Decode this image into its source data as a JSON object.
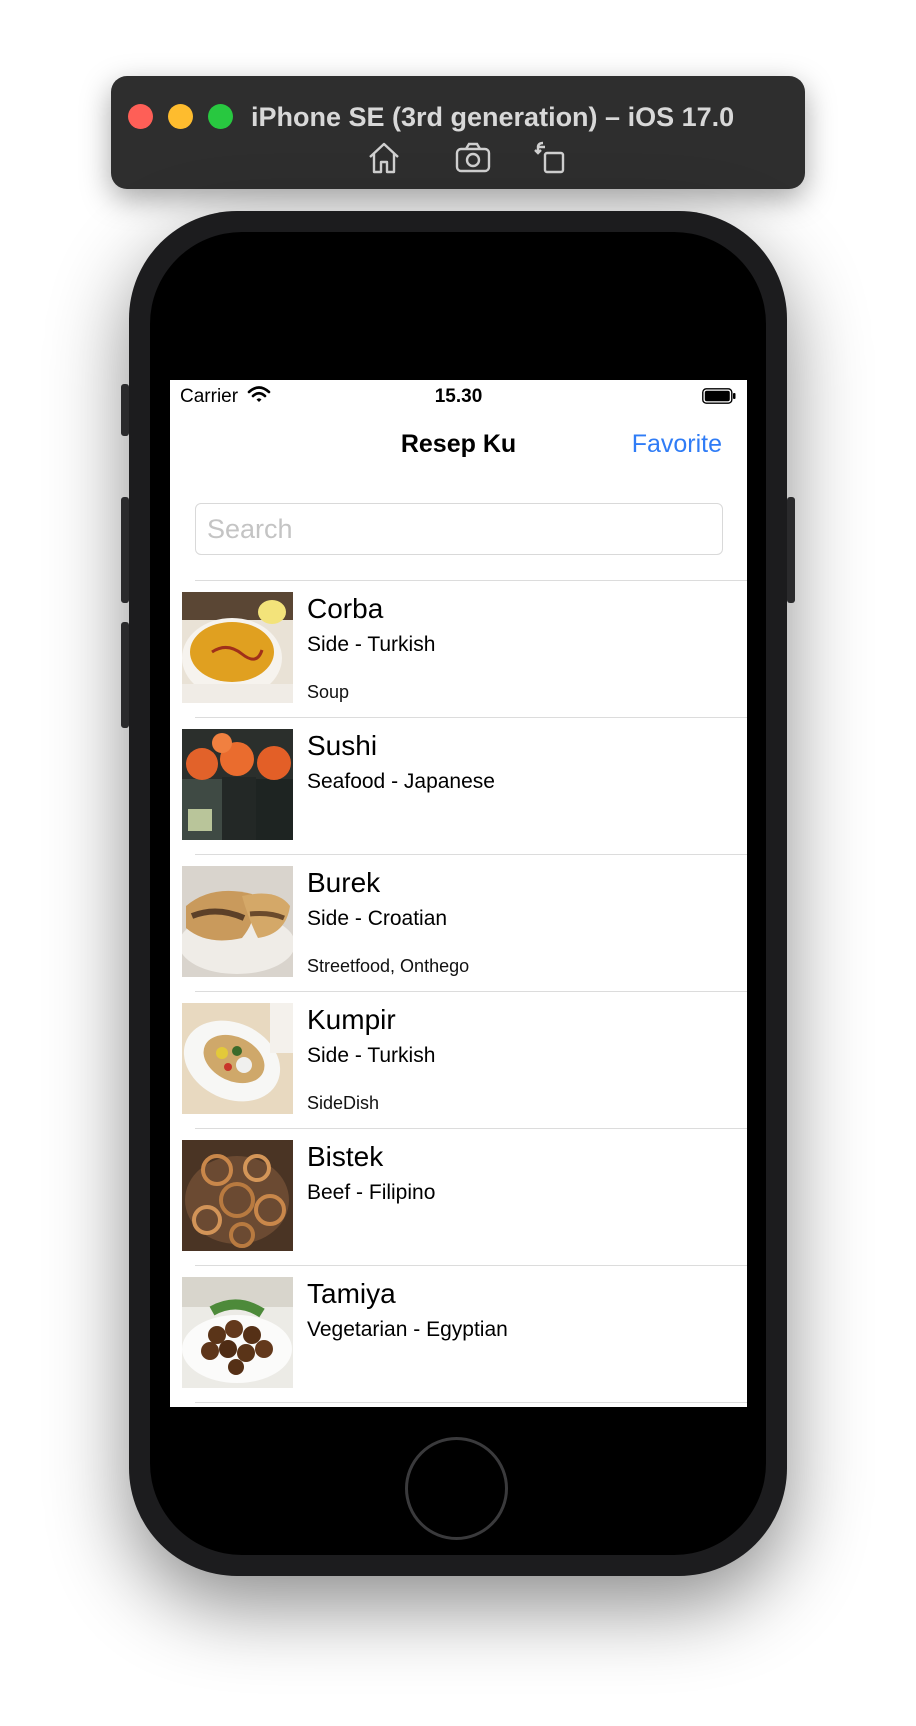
{
  "simulator": {
    "title": "iPhone SE (3rd generation) – iOS 17.0",
    "tools": [
      "home-icon",
      "screenshot-icon",
      "rotate-icon"
    ]
  },
  "status_bar": {
    "carrier": "Carrier",
    "time": "15.30"
  },
  "nav": {
    "title": "Resep Ku",
    "favorite": "Favorite"
  },
  "search": {
    "placeholder": "Search"
  },
  "accent_color": "#2f7cf6",
  "recipes": [
    {
      "name": "Corba",
      "subtitle": "Side - Turkish",
      "tags": "Soup"
    },
    {
      "name": "Sushi",
      "subtitle": "Seafood - Japanese",
      "tags": ""
    },
    {
      "name": "Burek",
      "subtitle": "Side - Croatian",
      "tags": "Streetfood, Onthego"
    },
    {
      "name": "Kumpir",
      "subtitle": "Side - Turkish",
      "tags": "SideDish"
    },
    {
      "name": "Bistek",
      "subtitle": "Beef - Filipino",
      "tags": ""
    },
    {
      "name": "Tamiya",
      "subtitle": "Vegetarian - Egyptian",
      "tags": ""
    }
  ]
}
